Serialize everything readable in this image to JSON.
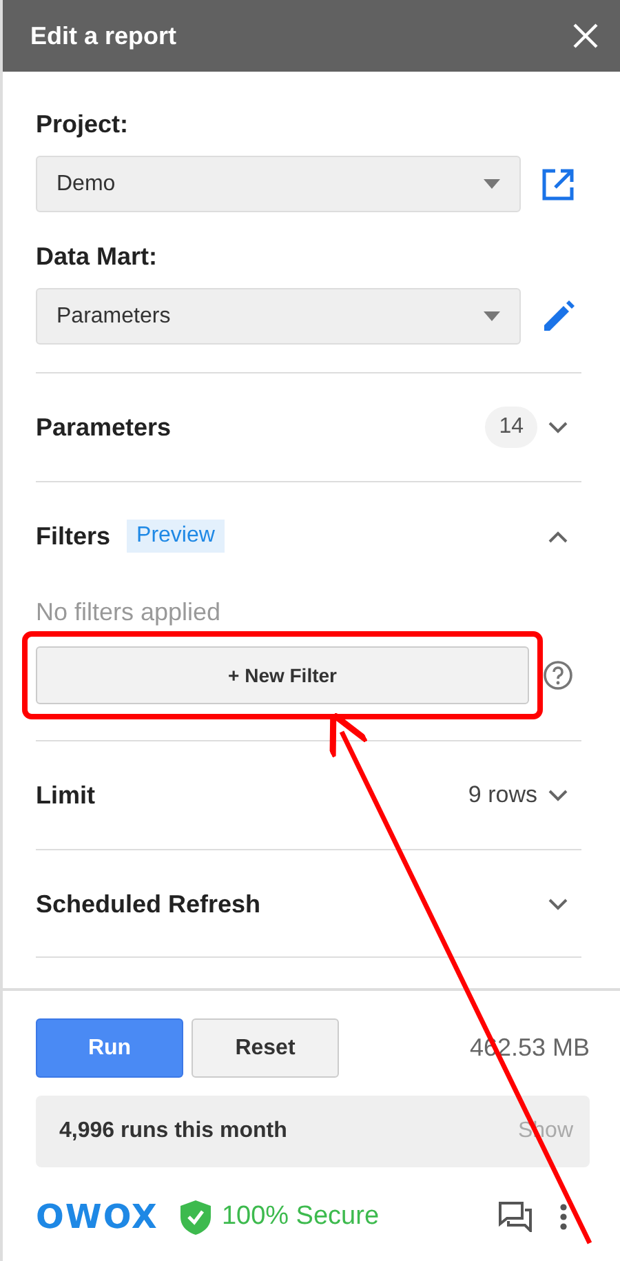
{
  "header": {
    "title": "Edit a report"
  },
  "fields": [
    {
      "label": "Project:",
      "value": "Demo",
      "kind": "open"
    },
    {
      "label": "Data Mart:",
      "value": "Parameters",
      "kind": "edit"
    }
  ],
  "sections": [
    {
      "title": "Parameters",
      "count": "14",
      "expanded": false
    },
    {
      "title": "Filters",
      "badge": "Preview",
      "expanded": true,
      "empty_text": "No filters applied",
      "button": "+ New Filter"
    },
    {
      "title": "Limit",
      "value": "9 rows",
      "expanded": false
    },
    {
      "title": "Scheduled Refresh",
      "expanded": false
    }
  ],
  "footer": {
    "buttons": [
      {
        "label": "Run",
        "kind": "primary"
      },
      {
        "label": "Reset",
        "kind": "secondary"
      }
    ],
    "size": "462.53 MB",
    "usage": {
      "text": "4,996 runs this month",
      "action": "Show"
    },
    "logo": "OWOX",
    "security": "100% Secure"
  }
}
